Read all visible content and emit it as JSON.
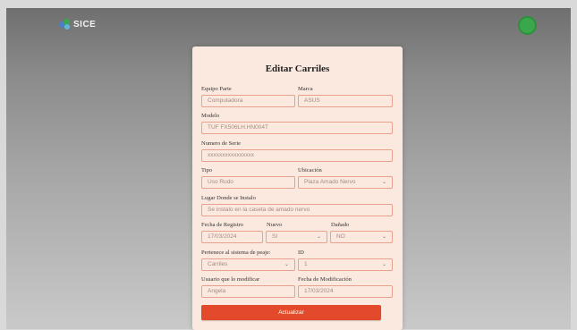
{
  "brand": {
    "logo_text": "SICE",
    "accent": "#e24a2b",
    "avatar_color": "#3aa84a"
  },
  "form": {
    "title": "Editar Carriles",
    "fields": {
      "equipo": {
        "label": "Equipo Parte",
        "value": "Computadora"
      },
      "marca": {
        "label": "Marca",
        "value": "ASUS"
      },
      "modelo": {
        "label": "Modelo",
        "value": "TUF FX506LH.HN004T"
      },
      "serie": {
        "label": "Numero de Serie",
        "value": "xxxxxxxxxxxxxxxx"
      },
      "tipo": {
        "label": "Tipo",
        "value": "Uso Rudo"
      },
      "ubicacion": {
        "label": "Ubicación",
        "value": "Plaza Amado Nervo"
      },
      "lugar": {
        "label": "Lugar Donde se Instalo",
        "value": "Se instalo en la caseta de amado nervo"
      },
      "fecha_registro": {
        "label": "Fecha de Registro",
        "value": "17/03/2024"
      },
      "nuevo": {
        "label": "Nuevo",
        "value": "SI"
      },
      "danado": {
        "label": "Dañado",
        "value": "NO"
      },
      "sistema": {
        "label": "Pertenece al sistema de peaje:",
        "value": "Carriles"
      },
      "id": {
        "label": "ID",
        "value": "1"
      },
      "usuario": {
        "label": "Usuario que lo modificar",
        "value": "Angela"
      },
      "fecha_mod": {
        "label": "Fecha de Modificación",
        "value": "17/03/2024"
      }
    },
    "submit_label": "Actualizar"
  }
}
